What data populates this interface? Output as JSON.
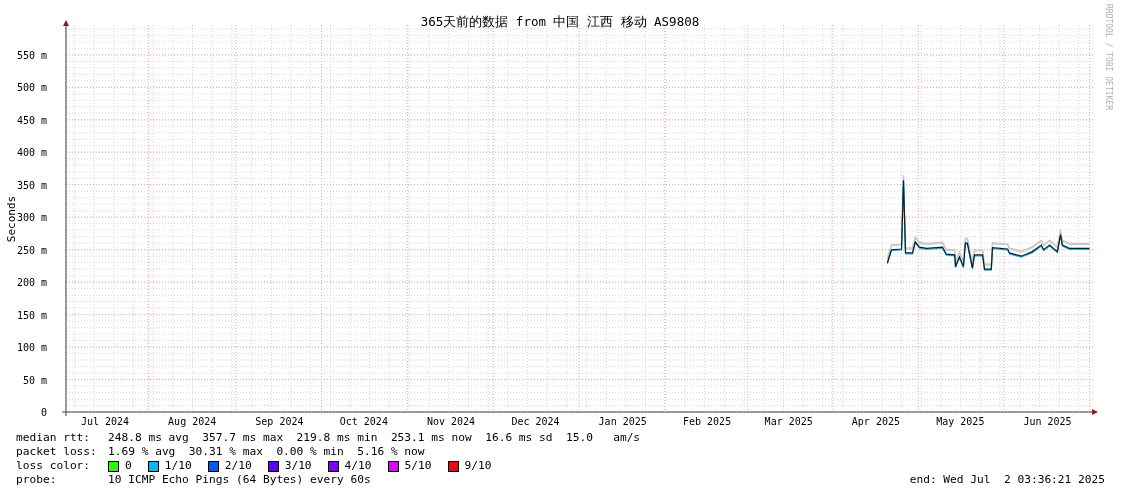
{
  "watermark": "RRDTOOL / TOBI OETIKER",
  "chart_data": {
    "type": "line",
    "grid": true,
    "title": "365天前的数据 from 中国 江西 移动 AS9808",
    "ylabel": "Seconds",
    "xlim": [
      "2024-07-02T03:36",
      "2025-07-02T03:36"
    ],
    "ylim": [
      0,
      596
    ],
    "xticks": [
      {
        "value": "2024-07-16",
        "label": "Jul 2024"
      },
      {
        "value": "2024-08-16",
        "label": "Aug 2024"
      },
      {
        "value": "2024-09-16",
        "label": "Sep 2024"
      },
      {
        "value": "2024-10-16",
        "label": "Oct 2024"
      },
      {
        "value": "2024-11-16",
        "label": "Nov 2024"
      },
      {
        "value": "2024-12-16",
        "label": "Dec 2024"
      },
      {
        "value": "2025-01-16",
        "label": "Jan 2025"
      },
      {
        "value": "2025-02-15",
        "label": "Feb 2025"
      },
      {
        "value": "2025-03-16",
        "label": "Mar 2025"
      },
      {
        "value": "2025-04-16",
        "label": "Apr 2025"
      },
      {
        "value": "2025-05-16",
        "label": "May 2025"
      },
      {
        "value": "2025-06-16",
        "label": "Jun 2025"
      }
    ],
    "yticks": [
      {
        "value": 0,
        "label": "0"
      },
      {
        "value": 50,
        "label": "50 m"
      },
      {
        "value": 100,
        "label": "100 m"
      },
      {
        "value": 150,
        "label": "150 m"
      },
      {
        "value": 200,
        "label": "200 m"
      },
      {
        "value": 250,
        "label": "250 m"
      },
      {
        "value": 300,
        "label": "300 m"
      },
      {
        "value": 350,
        "label": "350 m"
      },
      {
        "value": 400,
        "label": "400 m"
      },
      {
        "value": 450,
        "label": "450 m"
      },
      {
        "value": 500,
        "label": "500 m"
      },
      {
        "value": 550,
        "label": "550 m"
      }
    ],
    "x": [
      "2025-04-20T02:00",
      "2025-04-21T12:00",
      "2025-04-25T02:00",
      "2025-04-25T19:00",
      "2025-04-26T12:00",
      "2025-04-29T00:00",
      "2025-04-30T00:00",
      "2025-05-01T12:00",
      "2025-05-04T00:00",
      "2025-05-09T17:00",
      "2025-05-11T00:00",
      "2025-05-14T00:00",
      "2025-05-14T07:00",
      "2025-05-15T17:00",
      "2025-05-17T02:00",
      "2025-05-17T19:00",
      "2025-05-18T12:00",
      "2025-05-20T07:00",
      "2025-05-21T00:00",
      "2025-05-23T22:00",
      "2025-05-24T14:00",
      "2025-05-27T00:00",
      "2025-05-27T10:00",
      "2025-06-01T19:00",
      "2025-06-02T12:00",
      "2025-06-06T17:00",
      "2025-06-10T14:00",
      "2025-06-13T19:00",
      "2025-06-14T14:00",
      "2025-06-16T17:00",
      "2025-06-19T12:00",
      "2025-06-20T14:00",
      "2025-06-21T07:00",
      "2025-06-23T19:00",
      "2025-06-30T22:00"
    ],
    "series": [
      {
        "name": "median rtt:",
        "color": "#1a1a1a",
        "values": [
          230,
          250,
          251,
          357,
          245,
          245,
          262,
          254,
          252,
          254,
          243,
          242,
          224,
          239,
          224,
          260,
          260,
          222,
          242,
          242,
          220,
          220,
          253,
          251,
          245,
          240,
          247,
          257,
          250,
          257,
          247,
          273,
          257,
          252,
          252
        ]
      }
    ]
  },
  "legend": [
    {
      "value": "248.8 ms avg  357.7 ms max  219.8 ms min  253.1 ms now  16.6 ms sd  15.0   am/s"
    },
    {
      "label": "packet loss:",
      "value": "1.69 % avg  30.31 % max  0.00 % min  5.16 % now"
    }
  ],
  "loss_color": {
    "label": "loss color:",
    "items": [
      {
        "label": "0",
        "color": "#26ff00"
      },
      {
        "label": "1/10",
        "color": "#00b8ff"
      },
      {
        "label": "2/10",
        "color": "#0059ff"
      },
      {
        "label": "3/10",
        "color": "#5e00ff"
      },
      {
        "label": "4/10",
        "color": "#7e00ff"
      },
      {
        "label": "5/10",
        "color": "#dd00ff"
      },
      {
        "label": "9/10",
        "color": "#ff0000"
      }
    ]
  },
  "probe": {
    "label": "probe:",
    "value": "10 ICMP Echo Pings (64 Bytes) every 60s",
    "end": "end: Wed Jul  2 03:36:21 2025"
  }
}
